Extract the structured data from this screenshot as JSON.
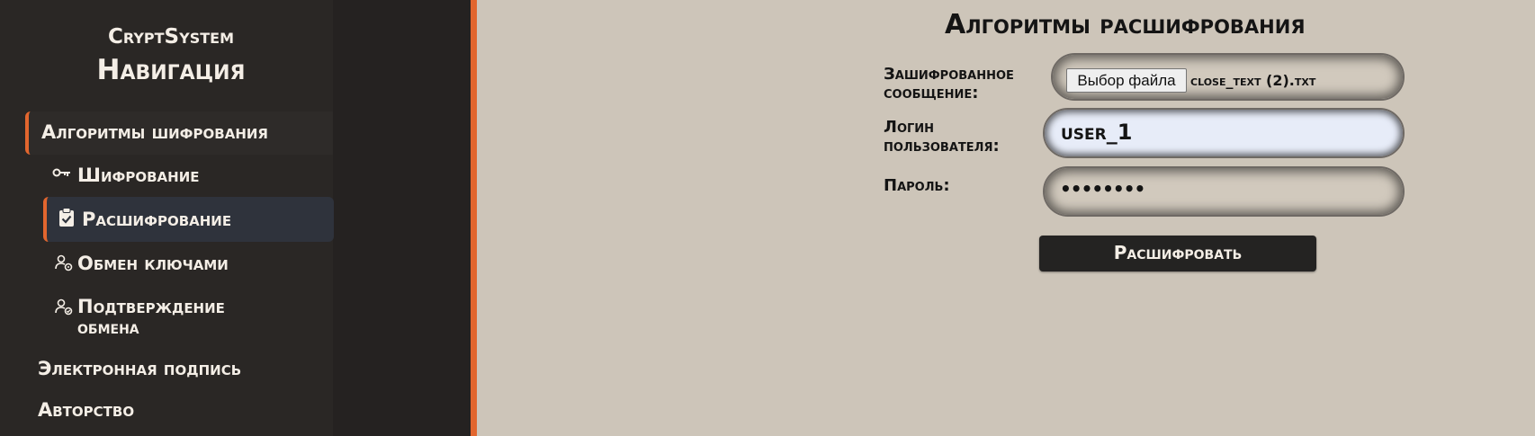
{
  "sidebar": {
    "brand": "CryptSystem",
    "nav_title": "Навигация",
    "groups": [
      {
        "label": "Алгоритмы шифрования",
        "active": true
      },
      {
        "label": "Электронная подпись"
      },
      {
        "label": "Авторство"
      }
    ],
    "subitems": [
      {
        "label": "Шифрование",
        "icon": "key-icon"
      },
      {
        "label": "Расшифрование",
        "icon": "clipboard-check-icon",
        "active": true
      },
      {
        "label": "Обмен ключами",
        "icon": "user-gear-icon"
      },
      {
        "label_line1": "Подтверждение",
        "label_line2": "обмена",
        "icon": "user-check-icon"
      }
    ]
  },
  "main": {
    "title": "Алгоритмы расшифрования",
    "fields": {
      "message_label_line1": "Зашифрованное",
      "message_label_line2": "сообщение:",
      "file_button": "Выбор файла",
      "file_name": "close_text (2).txt",
      "login_label_line1": "Логин",
      "login_label_line2": "пользователя:",
      "login_value": "user_1",
      "password_label": "Пароль:",
      "password_value": "••••••••"
    },
    "submit_label": "Расшифровать"
  },
  "colors": {
    "accent": "#e2662e",
    "sidebar_bg": "#252221",
    "main_bg": "#cdc5b9",
    "active_item_bg": "#2f333c",
    "button_bg": "#242322"
  }
}
